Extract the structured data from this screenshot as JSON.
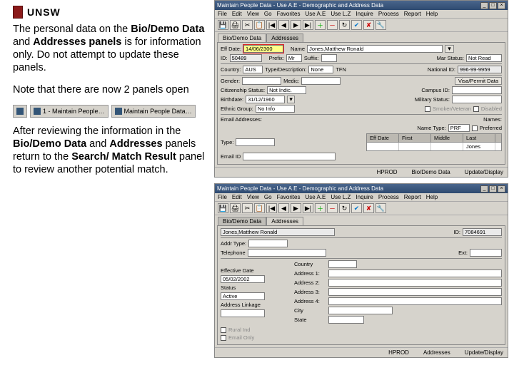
{
  "logo_text": "UNSW",
  "para1_a": "The personal data on the ",
  "para1_b1": "Bio/Demo Data",
  "para1_mid": " and ",
  "para1_b2": "Addresses panels",
  "para1_c": " is for information only. Do not attempt to update these panels.",
  "para2": "Note that there are now 2 panels open",
  "taskbar_item1": "1 - Maintain People…",
  "taskbar_item2": "Maintain People Data…",
  "para3_a": "After reviewing the information in the ",
  "para3_b1": "Bio/Demo Data",
  "para3_mid1": " and ",
  "para3_b2": "Addresses",
  "para3_mid2": " panels return to the ",
  "para3_b3": "Search/ Match Result",
  "para3_c": " panel to review another potential match.",
  "win1": {
    "title": "Maintain People Data - Use A.E - Demographic and Address Data",
    "menus": [
      "File",
      "Edit",
      "View",
      "Go",
      "Favorites",
      "Use A.E",
      "Use L.Z",
      "Inquire",
      "Process",
      "Report",
      "Help"
    ],
    "tabs": [
      "Bio/Demo Data",
      "Addresses"
    ],
    "labels": {
      "eff_date": "Eff Date:",
      "name": "Name",
      "id": "ID:",
      "prefix": "Prefix:",
      "suffix": "Suffix:",
      "mar_status": "Mar Status:",
      "country": "Country:",
      "type_desc": "Type/Description:",
      "tfn": "TFN",
      "national_id": "National ID:",
      "gender": "Gender:",
      "medic": "Medic:",
      "visa": "Visa/Permit Data",
      "citizen": "Citizenship Status:",
      "campus": "Campus ID:",
      "birthdate": "Birthdate:",
      "military": "Military Status:",
      "ethnic": "Ethnic Group:",
      "sm_vet": "Smoker/Veteran",
      "disabled": "Disabled",
      "email": "Email Addresses:",
      "names": "Names:",
      "name_type": "Name Type:",
      "preferred": "Preferred",
      "type": "Type:",
      "eff_date2": "Eff Date",
      "first": "First",
      "middle": "Middle",
      "last": "Last",
      "email_id": "Email ID"
    },
    "vals": {
      "eff_date": "14/06/2300",
      "name": "Jones,Matthew Ronald",
      "id": "50489",
      "prefix": "Mr",
      "suffix": "",
      "mar_status": "Not Read",
      "country": "AUS",
      "type_desc": "None",
      "national_id": "996-99-9959",
      "gender": "",
      "medic": "",
      "citizen": "Not Indic.",
      "campus": "",
      "birthdate": "31/12/1960",
      "military": "",
      "ethnic": "No Info",
      "names": "",
      "name_type": "PRF",
      "grid_eff": "",
      "grid_first": "",
      "grid_middle": "",
      "grid_last": "Jones",
      "type": "",
      "email_id": ""
    },
    "status": {
      "left": "HPROD",
      "mid": "Bio/Demo Data",
      "right": "Update/Display"
    }
  },
  "win2": {
    "title": "Maintain People Data - Use A.E - Demographic and Address Data",
    "menus": [
      "File",
      "Edit",
      "View",
      "Go",
      "Favorites",
      "Use A.E",
      "Use L.Z",
      "Inquire",
      "Process",
      "Report",
      "Help"
    ],
    "tabs": [
      "Bio/Demo Data",
      "Addresses"
    ],
    "labels": {
      "name_top": "",
      "id": "ID:",
      "addr_type": "Addr Type:",
      "telephone": "Telephone",
      "ext": "Ext:",
      "eff_date": "Effective Date",
      "country": "Country",
      "status": "Status",
      "addr1": "Address 1:",
      "addr2": "Address 2:",
      "addr_linkage": "Address Linkage",
      "addr3": "Address 3:",
      "addr4": "Address 4:",
      "city": "City",
      "state": "State",
      "rural": "Rural Ind",
      "email": "Email Only"
    },
    "vals": {
      "name_top": "Jones,Matthew Ronald",
      "id": "7084691",
      "addr_type": "",
      "telephone": "",
      "ext": "",
      "eff_date": "05/02/2002",
      "country": "",
      "status": "Active",
      "addr1": "",
      "addr2": "",
      "addr3": "",
      "addr4": "",
      "city": "",
      "state": ""
    },
    "status": {
      "left": "HPROD",
      "mid": "Addresses",
      "right": "Update/Display"
    }
  }
}
